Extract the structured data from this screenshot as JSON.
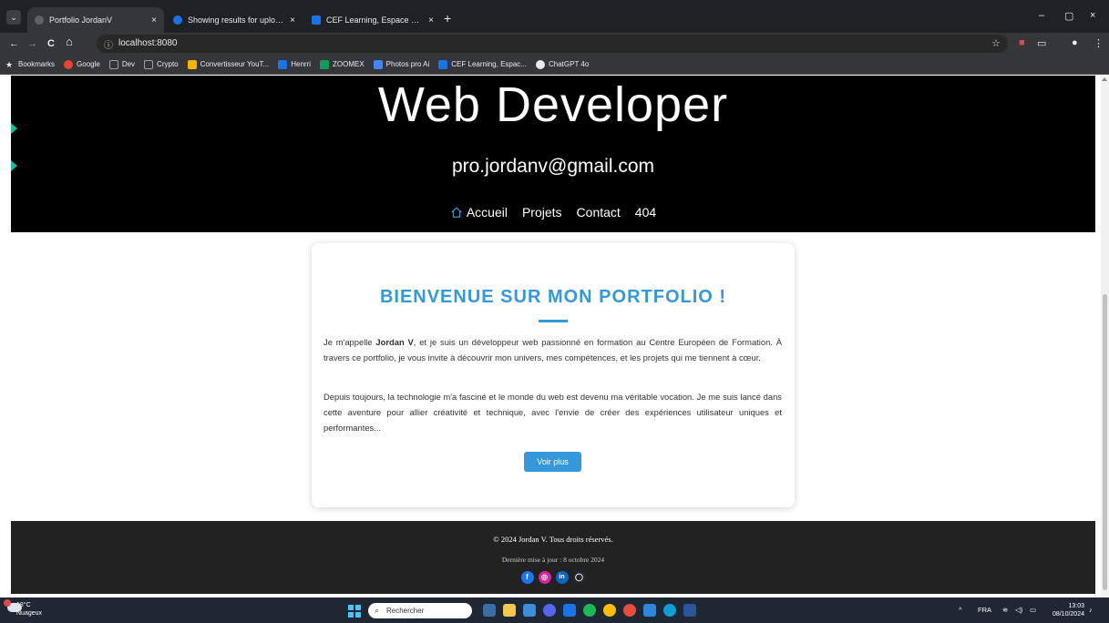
{
  "browser": {
    "tabs": [
      {
        "label": "Portfolio JordanV",
        "active": true,
        "favicon_color": "#5f6368"
      },
      {
        "label": "Showing results for uploaded fi",
        "active": false,
        "favicon_color": "#1a73e8"
      },
      {
        "label": "CEF Learning, Espace élève du C",
        "active": false,
        "favicon_color": "#1a73e8"
      }
    ],
    "tab_close": "×",
    "new_tab": "+",
    "window_controls": {
      "minimize": "–",
      "restore": "▢",
      "close": "×"
    },
    "nav": {
      "back": "←",
      "forward": "→",
      "reload": "C",
      "home": "⌂"
    },
    "url": "localhost:8080",
    "bookmarks": [
      {
        "label": "Bookmarks",
        "icon": "star-icon",
        "color": "#e8eaed"
      },
      {
        "label": "Google",
        "icon": "google-icon",
        "color": "#ea4335"
      },
      {
        "label": "Dev",
        "icon": "folder-icon",
        "color": "#9aa0a6"
      },
      {
        "label": "Crypto",
        "icon": "folder-icon",
        "color": "#9aa0a6"
      },
      {
        "label": "Convertisseur YouT...",
        "icon": "converter-icon",
        "color": "#f4b400"
      },
      {
        "label": "Henrri",
        "icon": "henrri-icon",
        "color": "#1a73e8"
      },
      {
        "label": "ZOOMEX",
        "icon": "zoomex-icon",
        "color": "#0f9d58"
      },
      {
        "label": "Photos pro Ai",
        "icon": "photo-icon",
        "color": "#4285f4"
      },
      {
        "label": "CEF Learning, Espac...",
        "icon": "cef-icon",
        "color": "#1a73e8"
      },
      {
        "label": "ChatGPT 4o",
        "icon": "chatgpt-icon",
        "color": "#e8eaed"
      }
    ]
  },
  "page": {
    "hero": {
      "title": "Web Developer",
      "email": "pro.jordanv@gmail.com",
      "nav": [
        "Accueil",
        "Projets",
        "Contact",
        "404"
      ],
      "accent_color": "#1abc9c"
    },
    "card": {
      "title": "BIENVENUE SUR MON PORTFOLIO !",
      "p1_before": "Je m'appelle ",
      "p1_name": "Jordan V",
      "p1_after": ", et je suis un développeur web passionné en formation au Centre Européen de Formation. À travers ce portfolio, je vous invite à découvrir mon univers, mes compétences, et les projets qui me tiennent à cœur.",
      "p2": "Depuis toujours, la technologie m'a fasciné et le monde du web est devenu ma véritable vocation. Je me suis lancé dans cette aventure pour allier créativité et technique, avec l'envie de créer des expériences utilisateur uniques et performantes...",
      "button": "Voir plus",
      "accent_color": "#3498db"
    },
    "footer": {
      "copyright": "© 2024 Jordan V. Tous droits réservés.",
      "updated": "Dernière mise à jour : 8 octobre 2024",
      "socials": [
        {
          "name": "facebook-icon",
          "glyph": "f",
          "color": "#1877f2"
        },
        {
          "name": "instagram-icon",
          "glyph": "◎",
          "color": "#d6249f"
        },
        {
          "name": "linkedin-icon",
          "glyph": "in",
          "color": "#0a66c2"
        },
        {
          "name": "github-icon",
          "glyph": "◯",
          "color": "#24292e"
        }
      ]
    }
  },
  "taskbar": {
    "weather_temp": "18°C",
    "weather_desc": "Nuageux",
    "search_placeholder": "Rechercher",
    "apps": [
      "#3a6ea5",
      "#f2c94c",
      "#3a8fd8",
      "#5865f2",
      "#1a73e8",
      "#1db954",
      "#fbbc04",
      "#e74c3c",
      "#2e86de",
      "#0f9ed5",
      "#2b579a"
    ],
    "language": "FRA",
    "time": "13:03",
    "date": "08/10/2024"
  }
}
